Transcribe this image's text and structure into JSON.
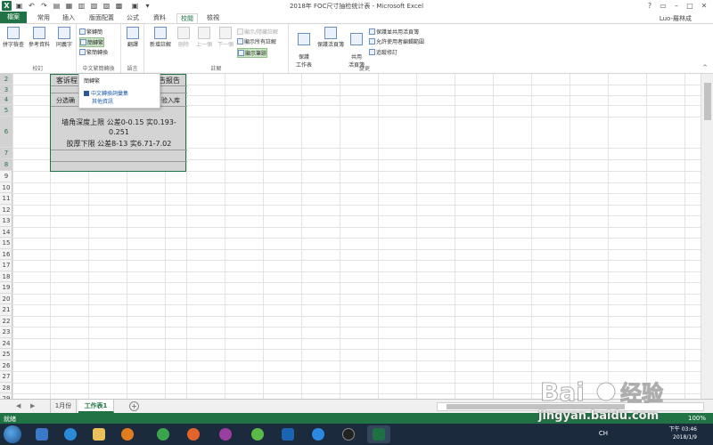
{
  "window": {
    "title": "2018年 FOC尺寸抽检统计表 - Microsoft Excel",
    "help": "?",
    "user": "Luo-羅林成",
    "min": "–",
    "max": "□",
    "close": "✕"
  },
  "tabs": {
    "file": "檔案",
    "items": [
      "常用",
      "插入",
      "版面配置",
      "公式",
      "資料",
      "校閱",
      "檢視"
    ],
    "active_index": 5
  },
  "ribbon": {
    "proofing": {
      "spell": "拼字檢查",
      "research": "參考資料",
      "thesaurus": "同義字",
      "label": "校訂"
    },
    "chinese": {
      "to_trad": "繁轉簡",
      "to_simp": "簡轉繁",
      "convert": "繁簡轉換",
      "label": "中文繁簡轉換"
    },
    "language": {
      "translate": "翻譯",
      "label": "語言"
    },
    "comments": {
      "new": "新增註解",
      "delete": "刪除",
      "prev": "上一個",
      "next": "下一個",
      "show_hide": "顯示/隱藏註解",
      "show_all": "顯示所有註解",
      "show_ink": "顯示筆跡",
      "label": "註解"
    },
    "changes": {
      "protect_sheet": "保護\n工作表",
      "protect_workbook": "保護活頁簿",
      "share_workbook": "共用\n活頁簿",
      "protect_share": "保護並共用活頁簿",
      "allow_edit": "允許使用者編輯範圍",
      "track": "追蹤修訂",
      "label": "變更"
    }
  },
  "dropdown": {
    "header": "簡轉繁",
    "item1": "中文轉換詞彙集",
    "item2": "其他資訊"
  },
  "sheet": {
    "rows": [
      "2",
      "3",
      "4",
      "5",
      "6",
      "7",
      "8",
      "9",
      "10",
      "11",
      "12",
      "13",
      "14",
      "15",
      "16",
      "17",
      "18",
      "19",
      "20",
      "21",
      "22",
      "23",
      "24",
      "25",
      "26",
      "27",
      "28",
      "29"
    ],
    "cell_title_left": "客诉程",
    "cell_title_right": "告报告",
    "cell_row4_left": "分选确",
    "cell_row4_right": "验入库",
    "cell_line1": "墙角深度上限 公差0-0.15 实0.193-",
    "cell_line2": "0.251",
    "cell_line3": "胶厚下限 公差8-13 实6.71-7.02"
  },
  "sheet_tabs": {
    "tabs": [
      "1月份",
      "工作表1"
    ],
    "active_index": 1,
    "add": "+"
  },
  "status": {
    "left": "就緒",
    "zoom": "100%"
  },
  "taskbar": {
    "ime": "CH",
    "time": "下午 03:46",
    "date": "2018/1/9"
  },
  "watermark": {
    "url": "jingyan.baidu.com"
  },
  "colors": {
    "excel_green": "#217346",
    "taskbar": "#1c2a3e"
  }
}
